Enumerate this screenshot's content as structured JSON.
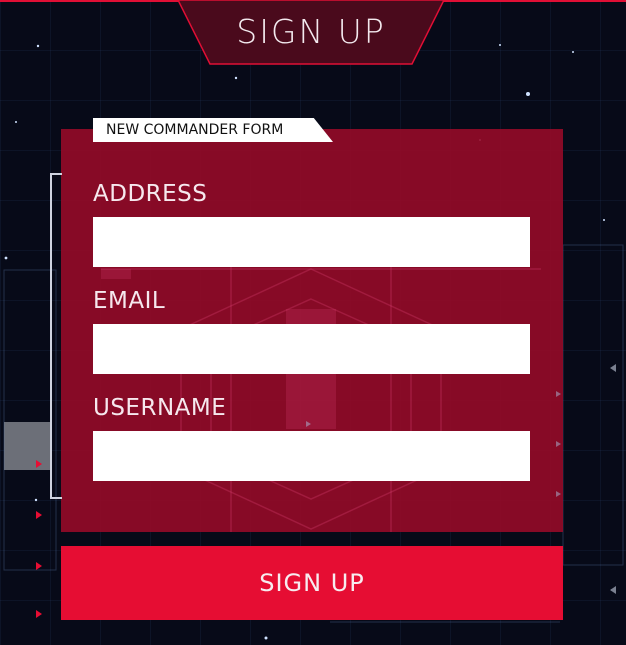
{
  "header": {
    "title": "SIGN UP"
  },
  "form": {
    "tag": "NEW COMMANDER FORM",
    "fields": [
      {
        "label": "ADDRESS",
        "value": ""
      },
      {
        "label": "EMAIL",
        "value": ""
      },
      {
        "label": "USERNAME",
        "value": ""
      }
    ]
  },
  "submit": {
    "label": "SIGN UP"
  },
  "colors": {
    "accent": "#e60d33",
    "panel": "#960a28",
    "background": "#070a18"
  },
  "icons": {
    "arrow": "triangle-arrow-icon",
    "star": "star-dot-icon"
  }
}
